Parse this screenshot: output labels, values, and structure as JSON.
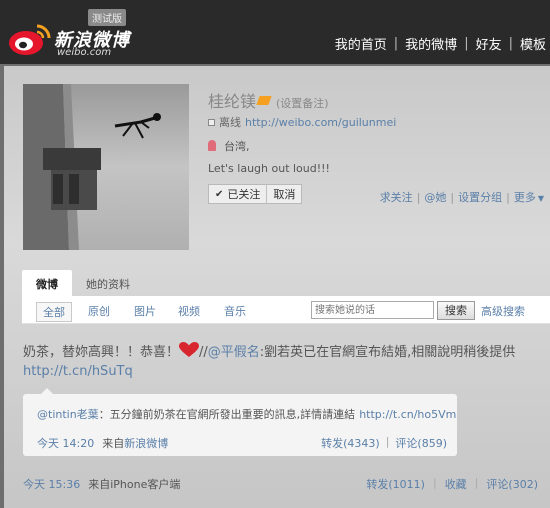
{
  "header": {
    "beta_badge": "测试版",
    "logo_text": "新浪微博",
    "logo_sub": "weibo.com",
    "nav": [
      "我的首页",
      "我的微博",
      "好友",
      "模板"
    ]
  },
  "profile": {
    "name": "桂纶镁",
    "remark_link": "(设置备注)",
    "status": "离线",
    "url": "http://weibo.com/guilunmei",
    "location": "台湾,",
    "bio": "Let's laugh out loud!!!",
    "followed_label": "已关注",
    "cancel_label": "取消",
    "actions": [
      "求关注",
      "@她",
      "设置分组",
      "更多"
    ]
  },
  "tabs": [
    "微博",
    "她的资料"
  ],
  "filters": [
    "全部",
    "原创",
    "图片",
    "视频",
    "音乐"
  ],
  "search": {
    "placeholder": "搜索她说的话",
    "button": "搜索",
    "advanced": "高级搜索"
  },
  "post": {
    "text_before": "奶茶，替妳高興！！恭喜！",
    "text_after": "//@平假名:劉若英已在官網宣布結婚,相關說明稍後提供",
    "mention": "@平假名",
    "mention_rest": ":劉若英已在官網宣布結婚,相關說明稍後提供",
    "link": "http://t.cn/hSuTq",
    "time": "今天 15:36",
    "via": "来自iPhone客户端",
    "repost": "转发(1011)",
    "favorite": "收藏",
    "comment": "评论(302)"
  },
  "retweet": {
    "user": "@tintin老葉",
    "text": "：五分鐘前奶茶在官網所發出重要的訊息,詳情請連結",
    "link": "http://t.cn/ho5Vm",
    "time": "今天 14:20",
    "via_prefix": "来自",
    "via_app": "新浪微博",
    "repost": "转发(4343)",
    "comment": "评论(859)"
  },
  "colors": {
    "link": "#5a7fa8",
    "verified": "#f5a020",
    "heart": "#d8262e"
  }
}
